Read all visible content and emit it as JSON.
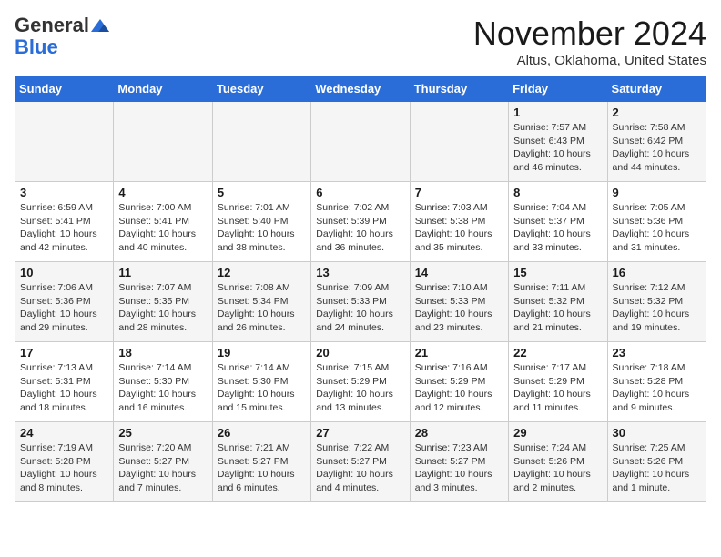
{
  "header": {
    "logo_general": "General",
    "logo_blue": "Blue",
    "month_title": "November 2024",
    "location": "Altus, Oklahoma, United States"
  },
  "weekdays": [
    "Sunday",
    "Monday",
    "Tuesday",
    "Wednesday",
    "Thursday",
    "Friday",
    "Saturday"
  ],
  "weeks": [
    {
      "days": [
        {
          "num": "",
          "info": ""
        },
        {
          "num": "",
          "info": ""
        },
        {
          "num": "",
          "info": ""
        },
        {
          "num": "",
          "info": ""
        },
        {
          "num": "",
          "info": ""
        },
        {
          "num": "1",
          "info": "Sunrise: 7:57 AM\nSunset: 6:43 PM\nDaylight: 10 hours and 46 minutes."
        },
        {
          "num": "2",
          "info": "Sunrise: 7:58 AM\nSunset: 6:42 PM\nDaylight: 10 hours and 44 minutes."
        }
      ]
    },
    {
      "days": [
        {
          "num": "3",
          "info": "Sunrise: 6:59 AM\nSunset: 5:41 PM\nDaylight: 10 hours and 42 minutes."
        },
        {
          "num": "4",
          "info": "Sunrise: 7:00 AM\nSunset: 5:41 PM\nDaylight: 10 hours and 40 minutes."
        },
        {
          "num": "5",
          "info": "Sunrise: 7:01 AM\nSunset: 5:40 PM\nDaylight: 10 hours and 38 minutes."
        },
        {
          "num": "6",
          "info": "Sunrise: 7:02 AM\nSunset: 5:39 PM\nDaylight: 10 hours and 36 minutes."
        },
        {
          "num": "7",
          "info": "Sunrise: 7:03 AM\nSunset: 5:38 PM\nDaylight: 10 hours and 35 minutes."
        },
        {
          "num": "8",
          "info": "Sunrise: 7:04 AM\nSunset: 5:37 PM\nDaylight: 10 hours and 33 minutes."
        },
        {
          "num": "9",
          "info": "Sunrise: 7:05 AM\nSunset: 5:36 PM\nDaylight: 10 hours and 31 minutes."
        }
      ]
    },
    {
      "days": [
        {
          "num": "10",
          "info": "Sunrise: 7:06 AM\nSunset: 5:36 PM\nDaylight: 10 hours and 29 minutes."
        },
        {
          "num": "11",
          "info": "Sunrise: 7:07 AM\nSunset: 5:35 PM\nDaylight: 10 hours and 28 minutes."
        },
        {
          "num": "12",
          "info": "Sunrise: 7:08 AM\nSunset: 5:34 PM\nDaylight: 10 hours and 26 minutes."
        },
        {
          "num": "13",
          "info": "Sunrise: 7:09 AM\nSunset: 5:33 PM\nDaylight: 10 hours and 24 minutes."
        },
        {
          "num": "14",
          "info": "Sunrise: 7:10 AM\nSunset: 5:33 PM\nDaylight: 10 hours and 23 minutes."
        },
        {
          "num": "15",
          "info": "Sunrise: 7:11 AM\nSunset: 5:32 PM\nDaylight: 10 hours and 21 minutes."
        },
        {
          "num": "16",
          "info": "Sunrise: 7:12 AM\nSunset: 5:32 PM\nDaylight: 10 hours and 19 minutes."
        }
      ]
    },
    {
      "days": [
        {
          "num": "17",
          "info": "Sunrise: 7:13 AM\nSunset: 5:31 PM\nDaylight: 10 hours and 18 minutes."
        },
        {
          "num": "18",
          "info": "Sunrise: 7:14 AM\nSunset: 5:30 PM\nDaylight: 10 hours and 16 minutes."
        },
        {
          "num": "19",
          "info": "Sunrise: 7:14 AM\nSunset: 5:30 PM\nDaylight: 10 hours and 15 minutes."
        },
        {
          "num": "20",
          "info": "Sunrise: 7:15 AM\nSunset: 5:29 PM\nDaylight: 10 hours and 13 minutes."
        },
        {
          "num": "21",
          "info": "Sunrise: 7:16 AM\nSunset: 5:29 PM\nDaylight: 10 hours and 12 minutes."
        },
        {
          "num": "22",
          "info": "Sunrise: 7:17 AM\nSunset: 5:29 PM\nDaylight: 10 hours and 11 minutes."
        },
        {
          "num": "23",
          "info": "Sunrise: 7:18 AM\nSunset: 5:28 PM\nDaylight: 10 hours and 9 minutes."
        }
      ]
    },
    {
      "days": [
        {
          "num": "24",
          "info": "Sunrise: 7:19 AM\nSunset: 5:28 PM\nDaylight: 10 hours and 8 minutes."
        },
        {
          "num": "25",
          "info": "Sunrise: 7:20 AM\nSunset: 5:27 PM\nDaylight: 10 hours and 7 minutes."
        },
        {
          "num": "26",
          "info": "Sunrise: 7:21 AM\nSunset: 5:27 PM\nDaylight: 10 hours and 6 minutes."
        },
        {
          "num": "27",
          "info": "Sunrise: 7:22 AM\nSunset: 5:27 PM\nDaylight: 10 hours and 4 minutes."
        },
        {
          "num": "28",
          "info": "Sunrise: 7:23 AM\nSunset: 5:27 PM\nDaylight: 10 hours and 3 minutes."
        },
        {
          "num": "29",
          "info": "Sunrise: 7:24 AM\nSunset: 5:26 PM\nDaylight: 10 hours and 2 minutes."
        },
        {
          "num": "30",
          "info": "Sunrise: 7:25 AM\nSunset: 5:26 PM\nDaylight: 10 hours and 1 minute."
        }
      ]
    }
  ]
}
